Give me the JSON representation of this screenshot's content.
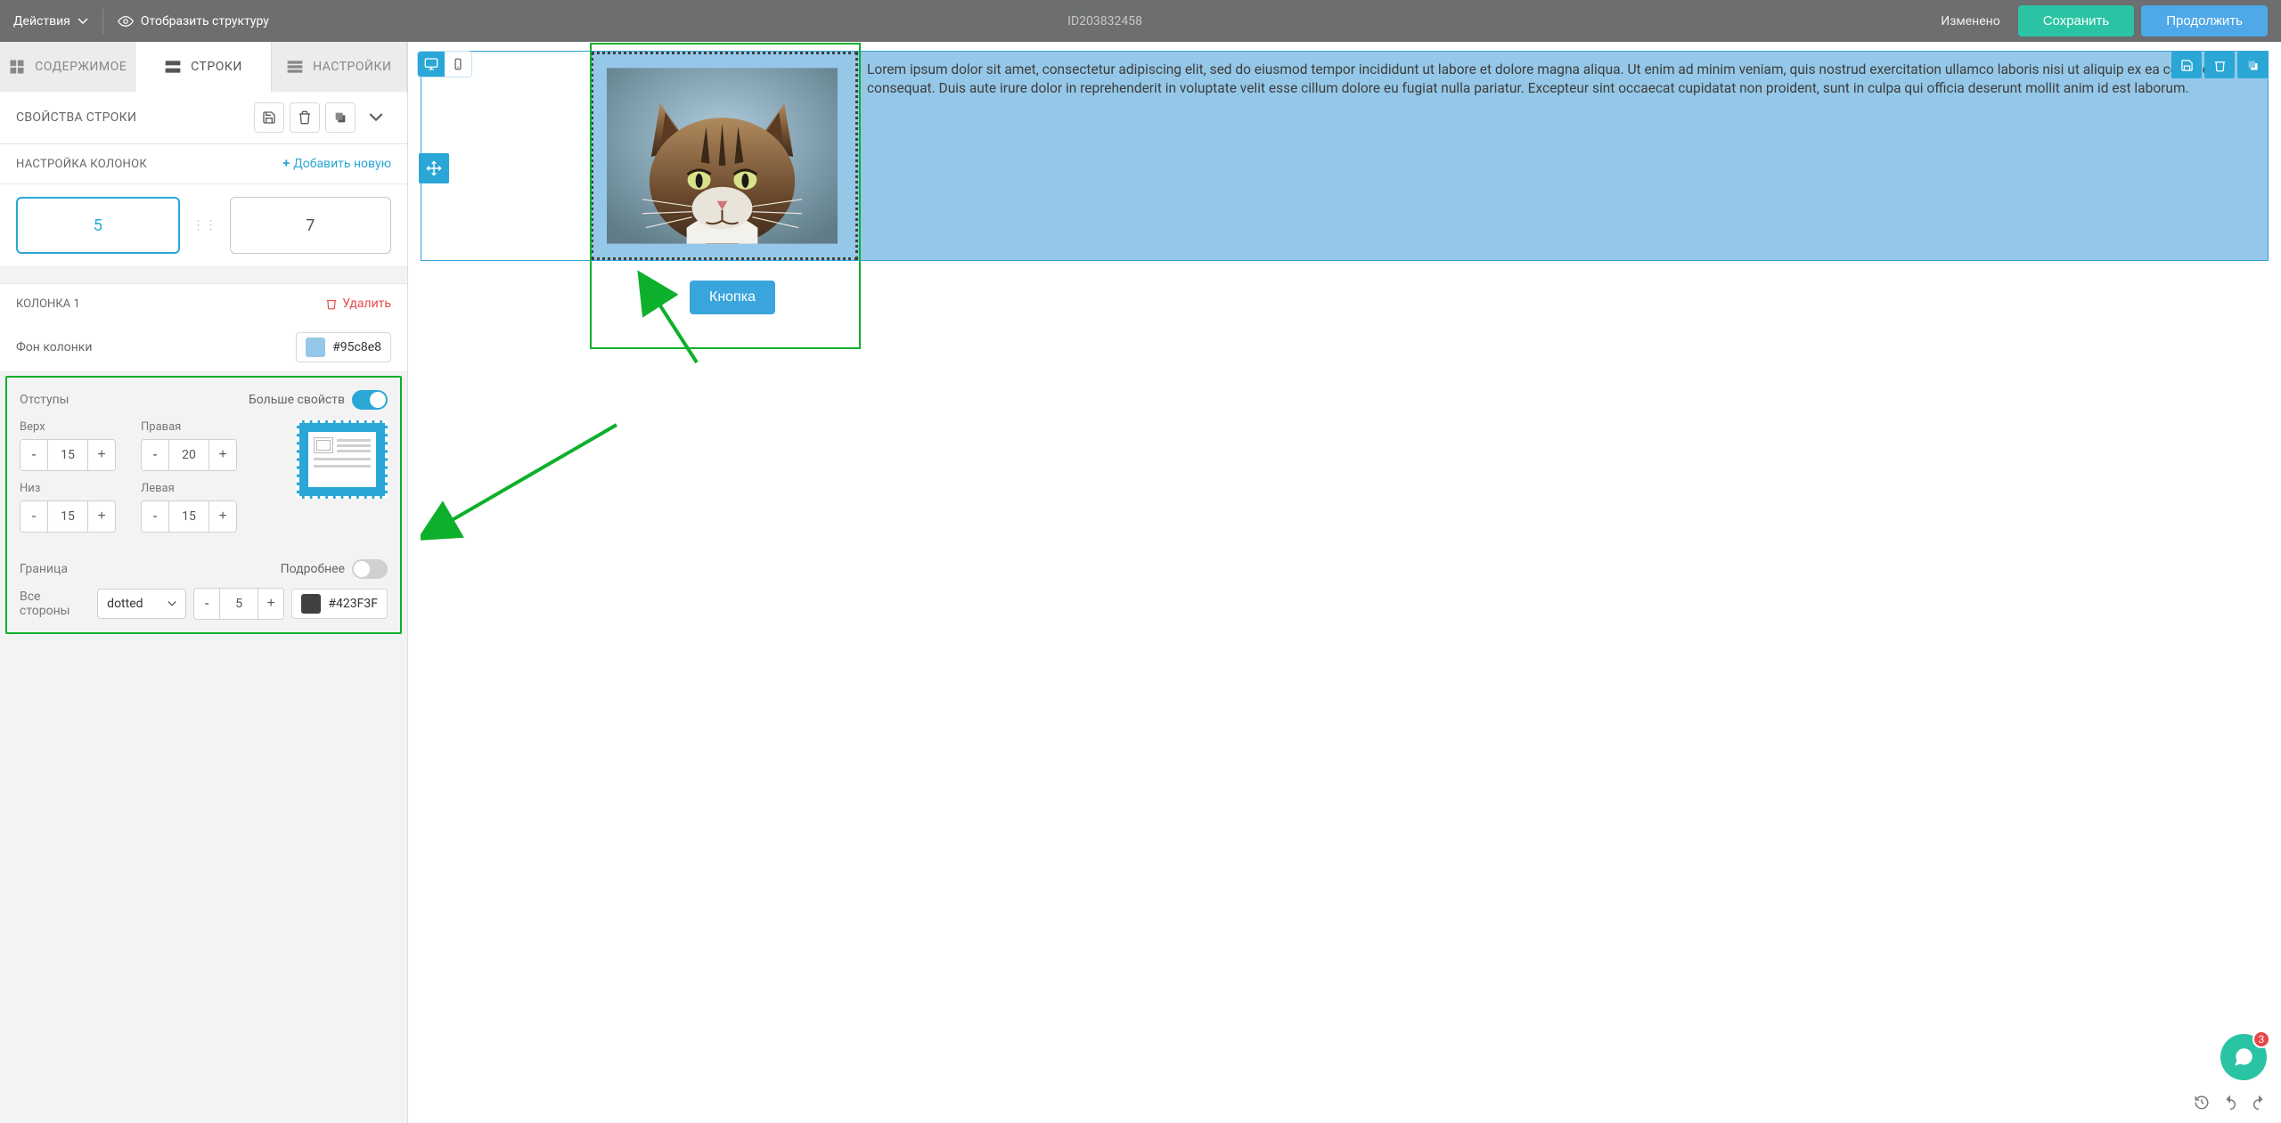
{
  "topbar": {
    "actions": "Действия",
    "showStructure": "Отобразить структуру",
    "id": "ID203832458",
    "status": "Изменено",
    "save": "Сохранить",
    "continue": "Продолжить"
  },
  "tabs": {
    "content": "СОДЕРЖИМОЕ",
    "rows": "СТРОКИ",
    "settings": "НАСТРОЙКИ"
  },
  "rowProps": {
    "title": "СВОЙСТВА СТРОКИ"
  },
  "colConfig": {
    "title": "НАСТРОЙКА КОЛОНОК",
    "add": "Добавить новую",
    "pill1": "5",
    "pill2": "7"
  },
  "colDetail": {
    "heading": "КОЛОНКА 1",
    "delete": "Удалить",
    "bgLabel": "Фон колонки",
    "bgValue": "#95c8e8"
  },
  "padding": {
    "label": "Отступы",
    "more": "Больше свойств",
    "top": "Верх",
    "topVal": "15",
    "right": "Правая",
    "rightVal": "20",
    "bottom": "Низ",
    "bottomVal": "15",
    "left": "Левая",
    "leftVal": "15"
  },
  "border": {
    "label": "Граница",
    "more": "Подробнее",
    "allSides": "Все стороны",
    "style": "dotted",
    "width": "5",
    "color": "#423F3F"
  },
  "canvas": {
    "lorem": "Lorem ipsum dolor sit amet, consectetur adipiscing elit, sed do eiusmod tempor incididunt ut labore et dolore magna aliqua. Ut enim ad minim veniam, quis nostrud exercitation ullamco laboris nisi ut aliquip ex ea commodo consequat. Duis aute irure dolor in reprehenderit in voluptate velit esse cillum dolore eu fugiat nulla pariatur. Excepteur sint occaecat cupidatat non proident, sunt in culpa qui officia deserunt mollit anim id est laborum.",
    "button": "Кнопка"
  },
  "chat": {
    "badge": "3"
  }
}
